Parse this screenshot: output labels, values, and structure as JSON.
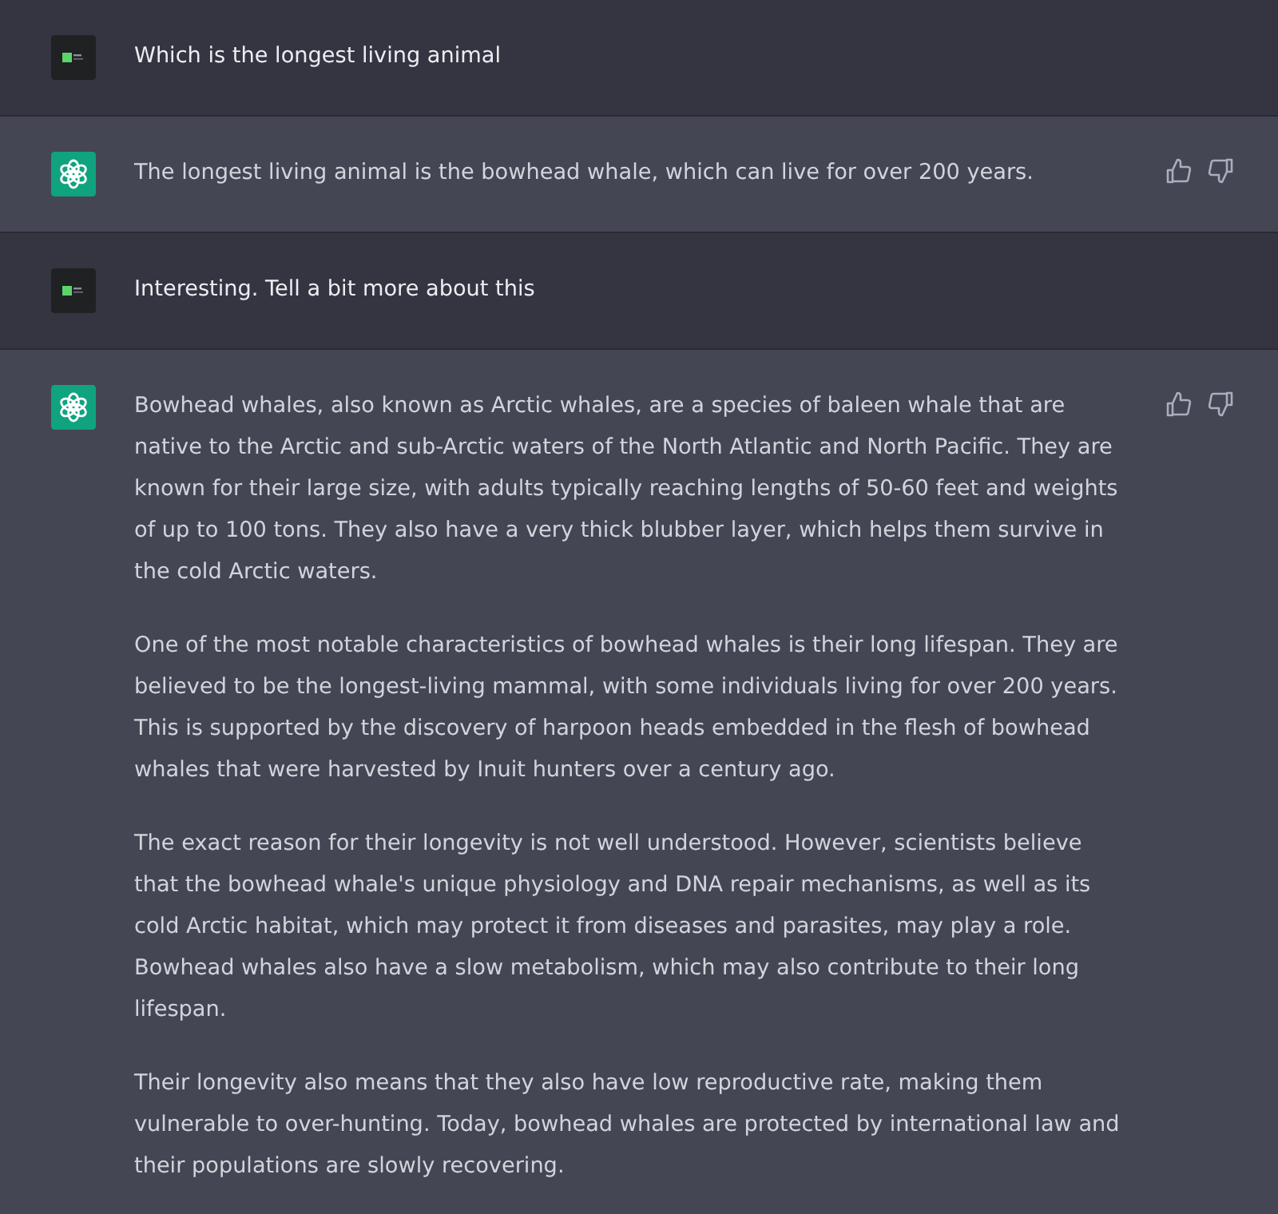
{
  "messages": [
    {
      "kind": "user",
      "paragraphs": [
        "Which is the longest living animal"
      ]
    },
    {
      "kind": "assistant",
      "paragraphs": [
        "The longest living animal is the bowhead whale, which can live for over 200 years."
      ]
    },
    {
      "kind": "user",
      "paragraphs": [
        "Interesting. Tell a bit more about this"
      ]
    },
    {
      "kind": "assistant",
      "paragraphs": [
        "Bowhead whales, also known as Arctic whales, are a species of baleen whale that are native to the Arctic and sub-Arctic waters of the North Atlantic and North Pacific. They are known for their large size, with adults typically reaching lengths of 50-60 feet and weights of up to 100 tons. They also have a very thick blubber layer, which helps them survive in the cold Arctic waters.",
        "One of the most notable characteristics of bowhead whales is their long lifespan. They are believed to be the longest-living mammal, with some individuals living for over 200 years. This is supported by the discovery of harpoon heads embedded in the flesh of bowhead whales that were harvested by Inuit hunters over a century ago.",
        "The exact reason for their longevity is not well understood. However, scientists believe that the bowhead whale's unique physiology and DNA repair mechanisms, as well as its cold Arctic habitat, which may protect it from diseases and parasites, may play a role. Bowhead whales also have a slow metabolism, which may also contribute to their long lifespan.",
        "Their longevity also means that they also have low reproductive rate, making them vulnerable to over-hunting. Today, bowhead whales are protected by international law and their populations are slowly recovering."
      ]
    }
  ]
}
